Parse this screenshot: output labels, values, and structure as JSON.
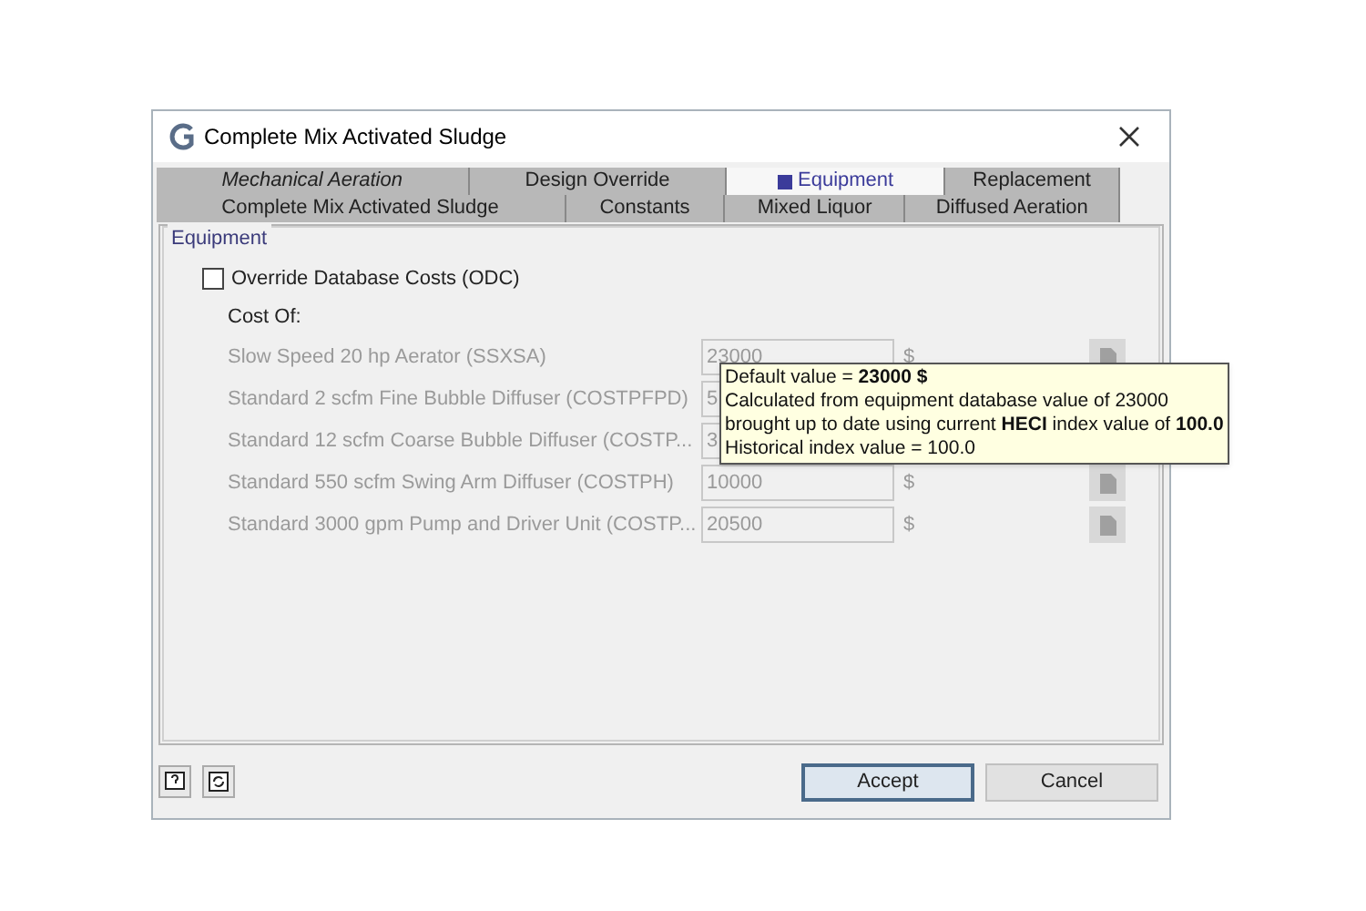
{
  "window": {
    "title": "Complete Mix Activated Sludge"
  },
  "tab_rows": [
    [
      {
        "label": "Mechanical Aeration",
        "selected": false,
        "disabled": true
      },
      {
        "label": "Design Override",
        "selected": false,
        "disabled": false
      },
      {
        "label": "Equipment",
        "selected": true,
        "disabled": false
      },
      {
        "label": "Replacement",
        "selected": false,
        "disabled": false
      }
    ],
    [
      {
        "label": "Complete Mix Activated Sludge",
        "selected": false,
        "disabled": false
      },
      {
        "label": "Constants",
        "selected": false,
        "disabled": false
      },
      {
        "label": "Mixed Liquor",
        "selected": false,
        "disabled": false
      },
      {
        "label": "Diffused Aeration",
        "selected": false,
        "disabled": false
      }
    ]
  ],
  "group": {
    "title": "Equipment",
    "override": {
      "label": "Override Database Costs (ODC)",
      "checked": false
    },
    "cost_heading": "Cost Of:",
    "rows": [
      {
        "label": "Slow Speed 20 hp Aerator (SSXSA)",
        "value": "23000",
        "unit": "$"
      },
      {
        "label": "Standard 2 scfm Fine Bubble Diffuser (COSTPFPD)",
        "value": "5"
      },
      {
        "label": "Standard 12 scfm Coarse Bubble Diffuser (COSTP...",
        "value": "3"
      },
      {
        "label": "Standard 550 scfm Swing Arm Diffuser (COSTPH)",
        "value": "10000",
        "unit": "$"
      },
      {
        "label": "Standard 3000 gpm Pump and Driver Unit (COSTP...",
        "value": "20500",
        "unit": "$"
      }
    ]
  },
  "tooltip": [
    "Default value = **23000 $**",
    "Calculated from equipment database value of 23000",
    "brought up to date using current **HECI** index value of **100.0**",
    "Historical index value = 100.0"
  ],
  "buttons": [
    {
      "label": "Accept",
      "selected": true
    },
    {
      "label": "Cancel",
      "selected": false
    }
  ]
}
